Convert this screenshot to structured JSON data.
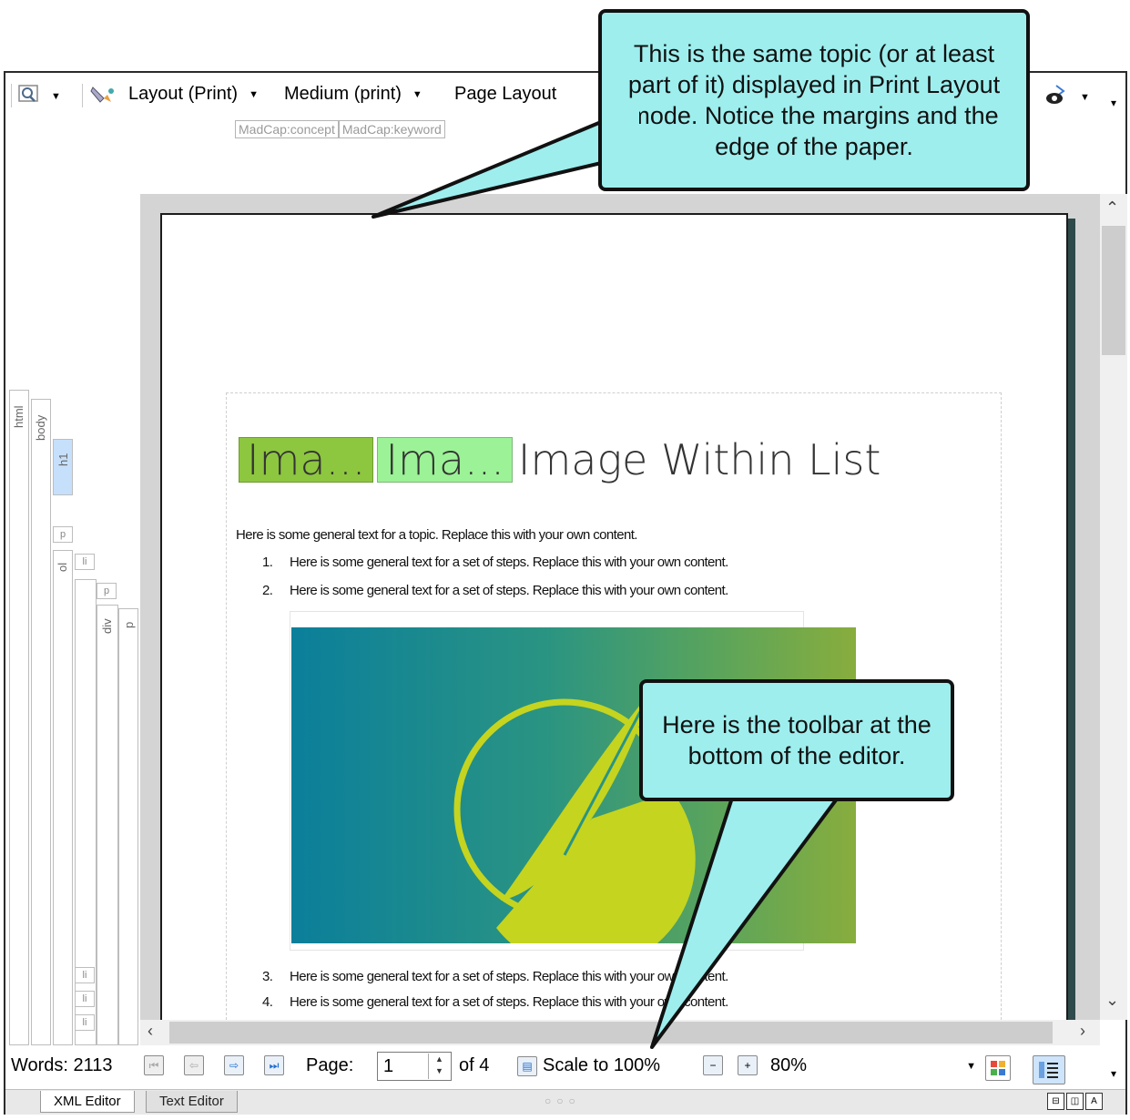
{
  "toolbar": {
    "layout_label": "Layout (Print)",
    "medium_label": "Medium (print)",
    "page_layout_label": "Page Layout"
  },
  "tags": [
    "MadCap:concept",
    "MadCap:keyword"
  ],
  "structure": {
    "html": "html",
    "body": "body",
    "h1": "h1",
    "p": "p",
    "ol": "ol",
    "li": "li",
    "div": "div"
  },
  "document": {
    "heading_var1": "Ima...",
    "heading_var2": "Ima...",
    "heading_text": "Image Within List",
    "intro": "Here is some general text for a topic. Replace this with your own content.",
    "steps": [
      {
        "num": "1.",
        "text": "Here is some general text for a set of steps. Replace this with your own content."
      },
      {
        "num": "2.",
        "text": "Here is some general text for a set of steps. Replace this with your own content."
      },
      {
        "num": "3.",
        "text": "Here is some general text for a set of steps. Replace this with your own content."
      },
      {
        "num": "4.",
        "text": "Here is some general text for a set of steps. Replace this with your own content."
      }
    ]
  },
  "bottombar": {
    "words": "Words: 2113",
    "page_label": "Page:",
    "page_value": "1",
    "of_label": "of 4",
    "scale_label": "Scale to 100%",
    "zoom_value": "80%"
  },
  "tabs": {
    "xml_editor": "XML Editor",
    "text_editor": "Text Editor"
  },
  "callouts": {
    "top": "This is the same topic (or at least part of it) displayed in Print Layout mode. Notice the margins and the edge of the paper.",
    "bottom": "Here is the toolbar at the bottom of the editor."
  },
  "colors": {
    "callout_fill": "#9eeeee",
    "variable1_fill": "#8dc63f",
    "variable2_fill": "#9cf296",
    "image_gradient_start": "#0b7f9b",
    "image_gradient_end": "#88ad3d",
    "logo": "#c5d41f"
  },
  "icons": [
    "preview-icon",
    "style-icon",
    "eye-icon",
    "first-page-icon",
    "previous-page-icon",
    "next-page-icon",
    "last-page-icon",
    "scale-icon",
    "zoom-out-icon",
    "zoom-in-icon",
    "layout-grid-icon",
    "show-tags-icon"
  ]
}
